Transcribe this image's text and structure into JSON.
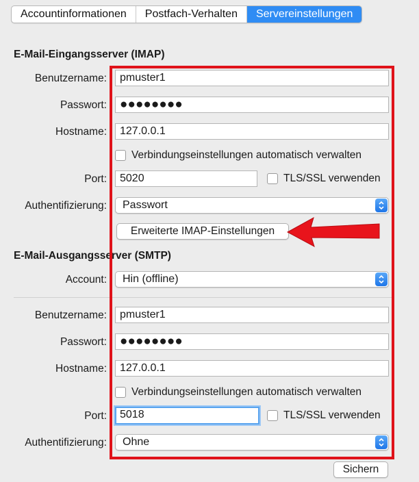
{
  "tabs": [
    {
      "label": "Accountinformationen",
      "active": false
    },
    {
      "label": "Postfach-Verhalten",
      "active": false
    },
    {
      "label": "Servereinstellungen",
      "active": true
    }
  ],
  "incoming": {
    "heading": "E-Mail-Eingangsserver (IMAP)",
    "username_label": "Benutzername:",
    "username_value": "pmuster1",
    "password_label": "Passwort:",
    "password_value": "●●●●●●●●",
    "hostname_label": "Hostname:",
    "hostname_value": "127.0.0.1",
    "auto_manage_label": "Verbindungseinstellungen automatisch verwalten",
    "auto_manage_checked": false,
    "port_label": "Port:",
    "port_value": "5020",
    "tls_label": "TLS/SSL verwenden",
    "tls_checked": false,
    "auth_label": "Authentifizierung:",
    "auth_value": "Passwort",
    "advanced_button": "Erweiterte IMAP-Einstellungen"
  },
  "outgoing": {
    "heading": "E-Mail-Ausgangsserver (SMTP)",
    "account_label": "Account:",
    "account_value": "Hin (offline)",
    "username_label": "Benutzername:",
    "username_value": "pmuster1",
    "password_label": "Passwort:",
    "password_value": "●●●●●●●●",
    "hostname_label": "Hostname:",
    "hostname_value": "127.0.0.1",
    "auto_manage_label": "Verbindungseinstellungen automatisch verwalten",
    "auto_manage_checked": false,
    "port_label": "Port:",
    "port_value": "5018",
    "tls_label": "TLS/SSL verwenden",
    "tls_checked": false,
    "auth_label": "Authentifizierung:",
    "auth_value": "Ohne"
  },
  "footer": {
    "save_button": "Sichern"
  },
  "colors": {
    "accent": "#2f8cf4",
    "annotation_red": "#e0121a",
    "focus_ring": "#5aa4ee"
  },
  "icons": {
    "popup": "chevron-up-down-icon",
    "annotation": "red-arrow-icon"
  }
}
